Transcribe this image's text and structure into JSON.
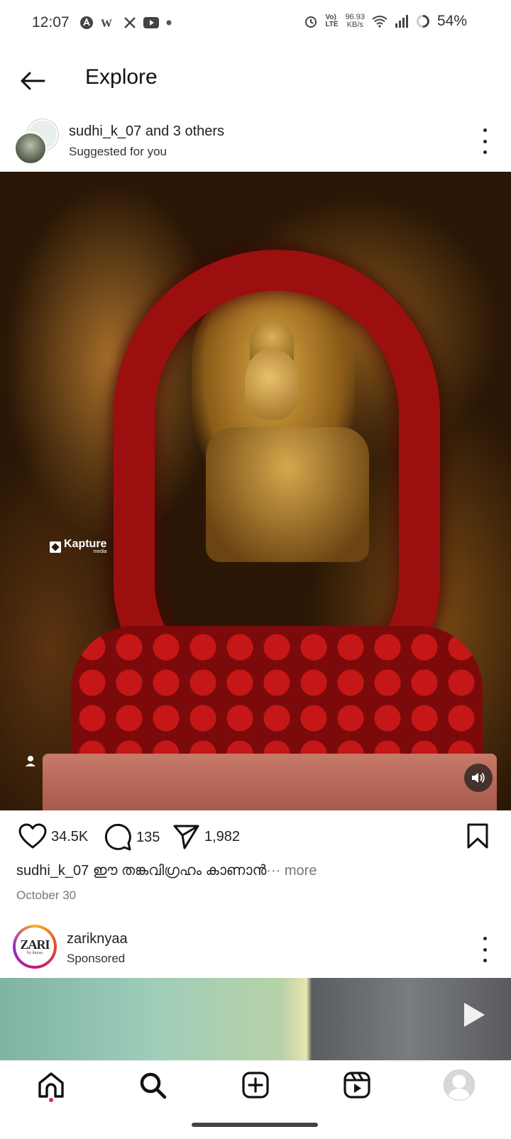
{
  "status_bar": {
    "time": "12:07",
    "data_rate": "96.93",
    "data_unit": "KB/s",
    "network_label": "Vo) LTE",
    "battery": "54%",
    "app_icons": [
      "assistant-icon",
      "w-icon",
      "x-icon",
      "youtube-icon",
      "dot-icon"
    ],
    "indicator_icons": [
      "alarm-icon",
      "wifi-icon",
      "signal-icon",
      "battery-ring-icon"
    ]
  },
  "header": {
    "title": "Explore"
  },
  "post1": {
    "user": "sudhi_k_07 and 3 others",
    "subtitle": "Suggested for you",
    "watermark": "Kapture",
    "watermark_sub": "media",
    "likes": "34.5K",
    "comments": "135",
    "shares": "1,982",
    "caption_user": "sudhi_k_07",
    "caption_text": "ഈ തങ്കവിഗ്രഹം കാണാൻ",
    "caption_ellipsis": "···",
    "caption_more": "more",
    "date": "October 30"
  },
  "post2": {
    "user": "zariknyaa",
    "subtitle": "Sponsored",
    "avatar_text": "ZARI",
    "avatar_sub": "by knyaa"
  },
  "nav": {
    "items": [
      "home-icon",
      "search-icon",
      "create-icon",
      "reels-icon",
      "profile-avatar"
    ]
  },
  "colors": {
    "notification_dot": "#e0245e",
    "text": "#222222",
    "muted": "#777777"
  }
}
